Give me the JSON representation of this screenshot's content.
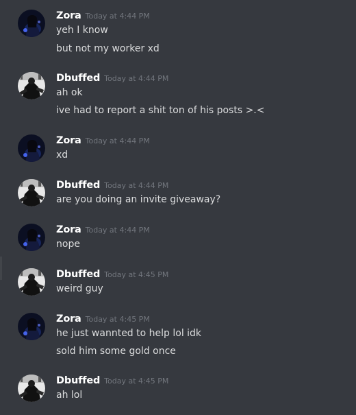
{
  "messages": [
    {
      "author": "Zora",
      "avatar": "zora-avatar",
      "timestamp": "Today at 4:44 PM",
      "lines": [
        "yeh I know",
        "but not my worker xd"
      ]
    },
    {
      "author": "Dbuffed",
      "avatar": "dbuffed-avatar",
      "timestamp": "Today at 4:44 PM",
      "lines": [
        "ah ok",
        "ive had to report a shit ton of his posts >.<"
      ]
    },
    {
      "author": "Zora",
      "avatar": "zora-avatar",
      "timestamp": "Today at 4:44 PM",
      "lines": [
        "xd"
      ]
    },
    {
      "author": "Dbuffed",
      "avatar": "dbuffed-avatar",
      "timestamp": "Today at 4:44 PM",
      "lines": [
        "are you doing an invite giveaway?"
      ]
    },
    {
      "author": "Zora",
      "avatar": "zora-avatar",
      "timestamp": "Today at 4:44 PM",
      "lines": [
        "nope"
      ]
    },
    {
      "author": "Dbuffed",
      "avatar": "dbuffed-avatar",
      "timestamp": "Today at 4:45 PM",
      "lines": [
        "weird guy"
      ]
    },
    {
      "author": "Zora",
      "avatar": "zora-avatar",
      "timestamp": "Today at 4:45 PM",
      "lines": [
        "he just wannted to help lol idk",
        "sold him some gold once"
      ]
    },
    {
      "author": "Dbuffed",
      "avatar": "dbuffed-avatar",
      "timestamp": "Today at 4:45 PM",
      "lines": [
        "ah lol"
      ]
    }
  ],
  "colors": {
    "background": "#36393f",
    "username": "#ffffff",
    "timestamp": "#72767d",
    "message_text": "#dcddde"
  }
}
